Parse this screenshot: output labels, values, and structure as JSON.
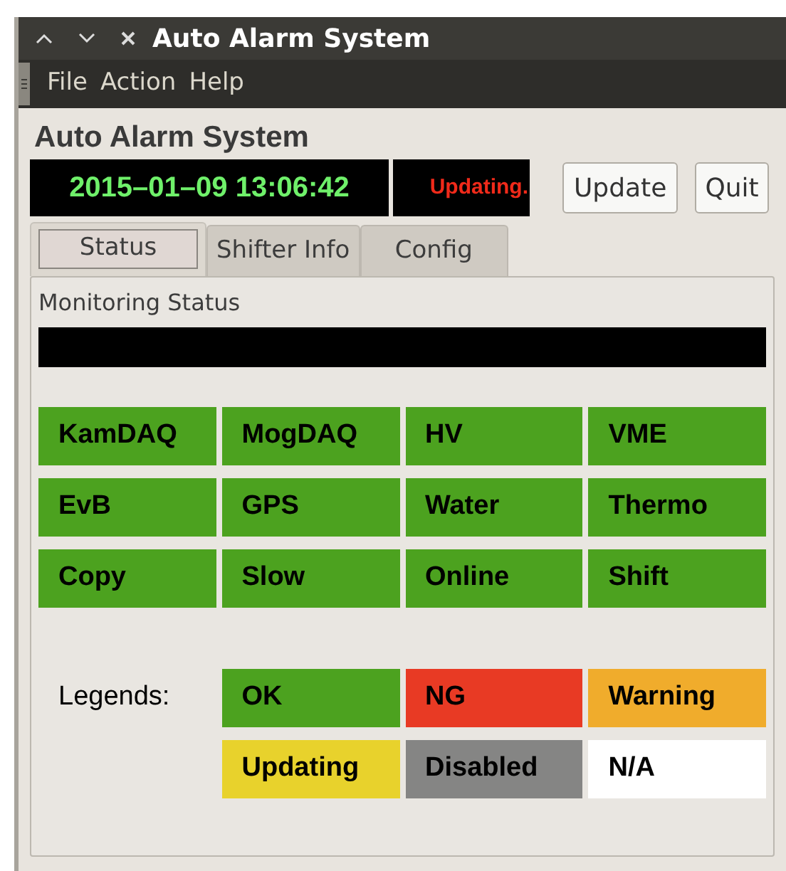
{
  "window": {
    "title": "Auto Alarm System"
  },
  "menu": [
    "File",
    "Action",
    "Help"
  ],
  "heading": "Auto Alarm System",
  "clock": "2015–01–09 13:06:42",
  "update_status": "Updating.",
  "buttons": [
    "Update",
    "Quit"
  ],
  "tabs": [
    {
      "label": "Status",
      "selected": true
    },
    {
      "label": "Shifter Info",
      "selected": false
    },
    {
      "label": "Config",
      "selected": false
    }
  ],
  "monitoring": {
    "title": "Monitoring Status",
    "items": [
      {
        "label": "KamDAQ",
        "color": "#4ca21f"
      },
      {
        "label": "MogDAQ",
        "color": "#4ca21f"
      },
      {
        "label": "HV",
        "color": "#4ca21f"
      },
      {
        "label": "VME",
        "color": "#4ca21f"
      },
      {
        "label": "EvB",
        "color": "#4ca21f"
      },
      {
        "label": "GPS",
        "color": "#4ca21f"
      },
      {
        "label": "Water",
        "color": "#4ca21f"
      },
      {
        "label": "Thermo",
        "color": "#4ca21f"
      },
      {
        "label": "Copy",
        "color": "#4ca21f"
      },
      {
        "label": "Slow",
        "color": "#4ca21f"
      },
      {
        "label": "Online",
        "color": "#4ca21f"
      },
      {
        "label": "Shift",
        "color": "#4ca21f"
      }
    ]
  },
  "legends": {
    "label": "Legends:",
    "items": [
      {
        "label": "OK",
        "color": "#4ca21f"
      },
      {
        "label": "NG",
        "color": "#e83a24"
      },
      {
        "label": "Warning",
        "color": "#f0ac2c"
      },
      {
        "label": "Updating",
        "color": "#e8d22c"
      },
      {
        "label": "Disabled",
        "color": "#858584"
      },
      {
        "label": "N/A",
        "color": "#ffffff"
      }
    ]
  }
}
